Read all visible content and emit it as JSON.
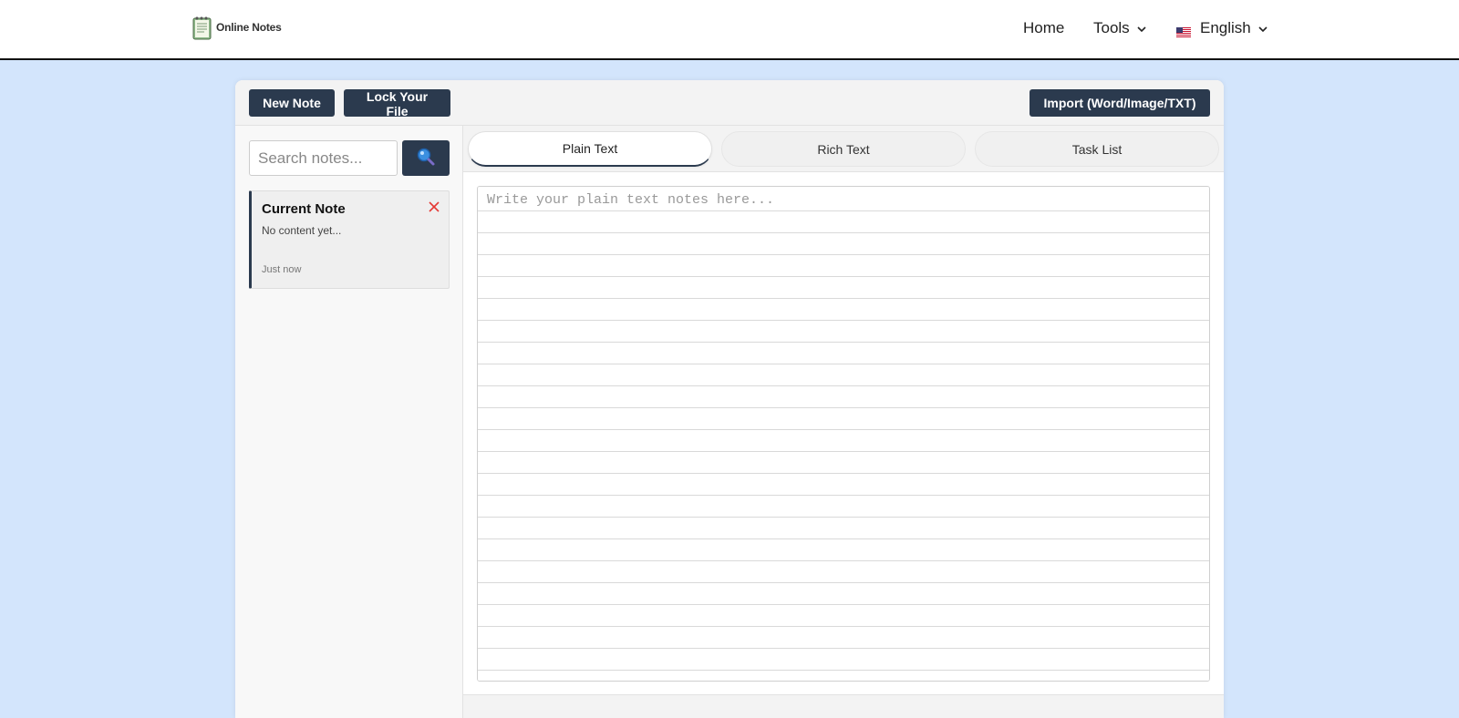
{
  "header": {
    "logo_text": "Online Notes",
    "nav": {
      "home": "Home",
      "tools": "Tools",
      "language": "English"
    }
  },
  "toolbar": {
    "new_note": "New Note",
    "lock_file": "Lock Your File",
    "import": "Import (Word/Image/TXT)"
  },
  "sidebar": {
    "search_placeholder": "Search notes...",
    "notes": [
      {
        "title": "Current Note",
        "preview": "No content yet...",
        "time": "Just now"
      }
    ]
  },
  "tabs": [
    {
      "label": "Plain Text",
      "active": true
    },
    {
      "label": "Rich Text",
      "active": false
    },
    {
      "label": "Task List",
      "active": false
    }
  ],
  "editor": {
    "placeholder": "Write your plain text notes here...",
    "value": ""
  },
  "colors": {
    "page_background": "#d3e5fc",
    "button_dark": "#2b3a4e",
    "close_red": "#e53935"
  }
}
